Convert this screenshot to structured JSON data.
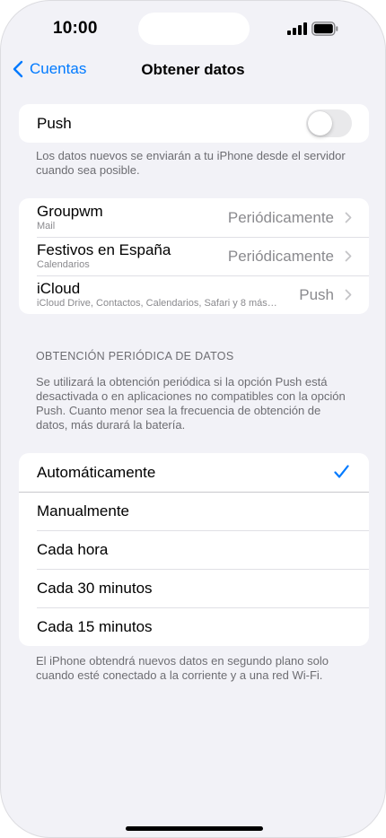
{
  "status_bar": {
    "time": "10:00",
    "icons": [
      "cellular-signal-icon",
      "battery-icon"
    ]
  },
  "nav": {
    "back_label": "Cuentas",
    "title": "Obtener datos"
  },
  "push": {
    "label": "Push",
    "enabled": false,
    "footer": "Los datos nuevos se enviarán a tu iPhone desde el servidor cuando sea posible."
  },
  "accounts": [
    {
      "name": "Groupwm",
      "subtitle": "Mail",
      "value": "Periódicamente"
    },
    {
      "name": "Festivos en España",
      "subtitle": "Calendarios",
      "value": "Periódicamente"
    },
    {
      "name": "iCloud",
      "subtitle": "iCloud Drive, Contactos, Calendarios, Safari y 8 más…",
      "value": "Push"
    }
  ],
  "fetch": {
    "header": "OBTENCIÓN PERIÓDICA DE DATOS",
    "description": "Se utilizará la obtención periódica si la opción Push está desactivada o en aplicaciones no compatibles con la opción Push. Cuanto menor sea la frecuencia de obtención de datos, más durará la batería.",
    "options": [
      "Automáticamente",
      "Manualmente",
      "Cada hora",
      "Cada 30 minutos",
      "Cada 15 minutos"
    ],
    "selected": "Automáticamente",
    "footer": "El iPhone obtendrá nuevos datos en segundo plano solo cuando esté conectado a la corriente y a una red Wi-Fi."
  },
  "colors": {
    "accent": "#007aff",
    "background": "#f2f2f7",
    "secondary_text": "#8a8a8e",
    "toggle_off": "#e9e9eb"
  }
}
